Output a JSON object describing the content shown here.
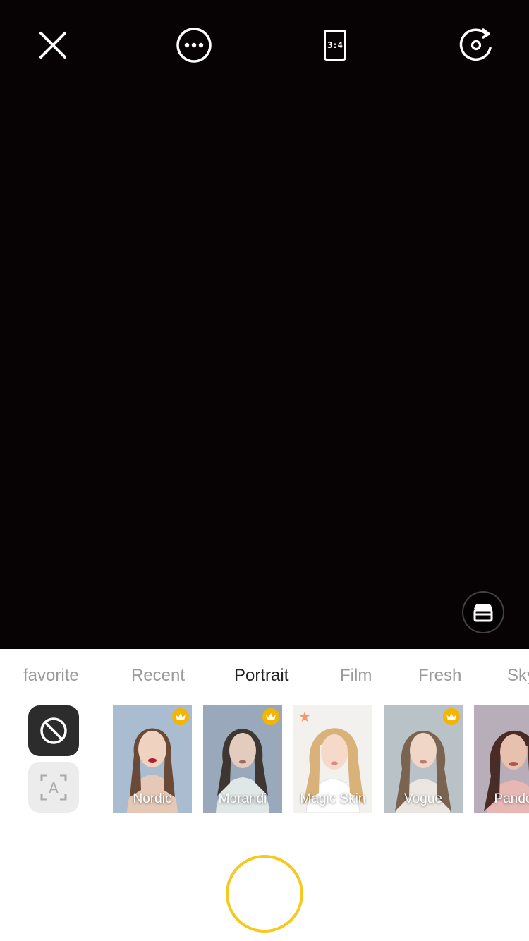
{
  "app": {
    "top_bar": {
      "close_icon": "close-icon",
      "more_icon": "more-icon",
      "ratio_label": "3:4",
      "flip_icon": "flip-camera-icon"
    },
    "store_icon": "store-icon"
  },
  "filter_panel": {
    "tabs": [
      {
        "label": "favorite",
        "active": false
      },
      {
        "label": "Recent",
        "active": false
      },
      {
        "label": "Portrait",
        "active": true
      },
      {
        "label": "Film",
        "active": false
      },
      {
        "label": "Fresh",
        "active": false
      },
      {
        "label": "Sky",
        "active": false
      }
    ],
    "tools": {
      "none_icon": "no-filter-icon",
      "ai_icon": "auto-filter-icon"
    },
    "filters": [
      {
        "label": "Nordic",
        "badge": "crown",
        "bg": "#a9bcd0"
      },
      {
        "label": "Morandi",
        "badge": "crown",
        "bg": "#9aa8bb"
      },
      {
        "label": "Magic Skin",
        "badge": "star",
        "bg": "#f3f1ee"
      },
      {
        "label": "Vogue",
        "badge": "crown",
        "bg": "#b9c2c7"
      },
      {
        "label": "Pando",
        "badge": "none",
        "bg": "#b8aeb9"
      }
    ]
  },
  "shutter": {
    "icon": "shutter-button"
  },
  "colors": {
    "viewfinder": "#070304",
    "accent_shutter": "#f7c81e",
    "badge_crown": "#f5b400",
    "tab_active": "#222222",
    "tab_inactive": "#9a9a9a"
  }
}
